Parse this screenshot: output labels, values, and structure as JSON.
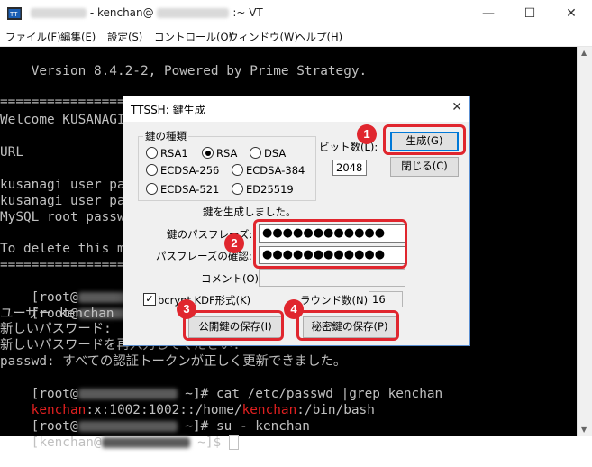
{
  "window": {
    "title_suffix": "- kenchan@",
    "title_tail": ":~ VT",
    "minimize": "—",
    "maximize": "☐",
    "close": "✕"
  },
  "menu": [
    "ファイル(F)",
    "編集(E)",
    "設定(S)",
    "コントロール(O)",
    "ウィンドウ(W)",
    "ヘルプ(H)"
  ],
  "terminal": {
    "version": "    Version 8.4.2-2, Powered by Prime Strategy.",
    "sep1": "==================",
    "welcome": "Welcome KUSANAGI",
    "url": "URL",
    "user_pass_1": "kusanagi user pas",
    "user_pass_2": "kusanagi user pas",
    "mysql": "MySQL root passw",
    "to_delete": "To delete this me",
    "sep2": "==================",
    "root1": "[root@",
    "root2": "[root@",
    "user_line": "ユーザー kenchan",
    "newpw1": "新しいパスワード:",
    "newpw2": "新しいパスワードを再入力してください:",
    "passwd_ok": "passwd: すべての認証トークンが正しく更新できました。",
    "root3_pre": "[root@",
    "root3_post": " ~]# cat /etc/passwd |grep kenchan",
    "passwd_line_user": "kenchan",
    "passwd_line_mid": ":x:1002:1002::/home/",
    "passwd_line_user2": "kenchan",
    "passwd_line_end": ":/bin/bash",
    "root4_pre": "[root@",
    "root4_post": " ~]# su - kenchan",
    "kenchan_pre": "[kenchan@",
    "kenchan_post": " ~]$ "
  },
  "dialog": {
    "title": "TTSSH: 鍵生成",
    "close": "✕",
    "key_type_label": "鍵の種類",
    "key_types": [
      "RSA1",
      "RSA",
      "DSA",
      "ECDSA-256",
      "ECDSA-384",
      "ECDSA-521",
      "ED25519"
    ],
    "selected_key_type": "RSA",
    "bits_label": "ビット数(L):",
    "bits_value": "2048",
    "generate_button": "生成(G)",
    "close_button": "閉じる(C)",
    "status": "鍵を生成しました。",
    "passphrase_label": "鍵のパスフレーズ:",
    "passphrase_value": "●●●●●●●●●●●●",
    "confirm_label": "パスフレーズの確認:",
    "confirm_value": "●●●●●●●●●●●●",
    "comment_label": "コメント(O):",
    "comment_value": "",
    "bcrypt_label": "bcrypt KDF形式(K)",
    "bcrypt_checked": "✓",
    "rounds_label": "ラウンド数(N):",
    "rounds_value": "16",
    "save_public_button": "公開鍵の保存(I)",
    "save_private_button": "秘密鍵の保存(P)"
  },
  "annotations": {
    "badge1": "1",
    "badge2": "2",
    "badge3": "3",
    "badge4": "4",
    "color": "#e0262e"
  }
}
